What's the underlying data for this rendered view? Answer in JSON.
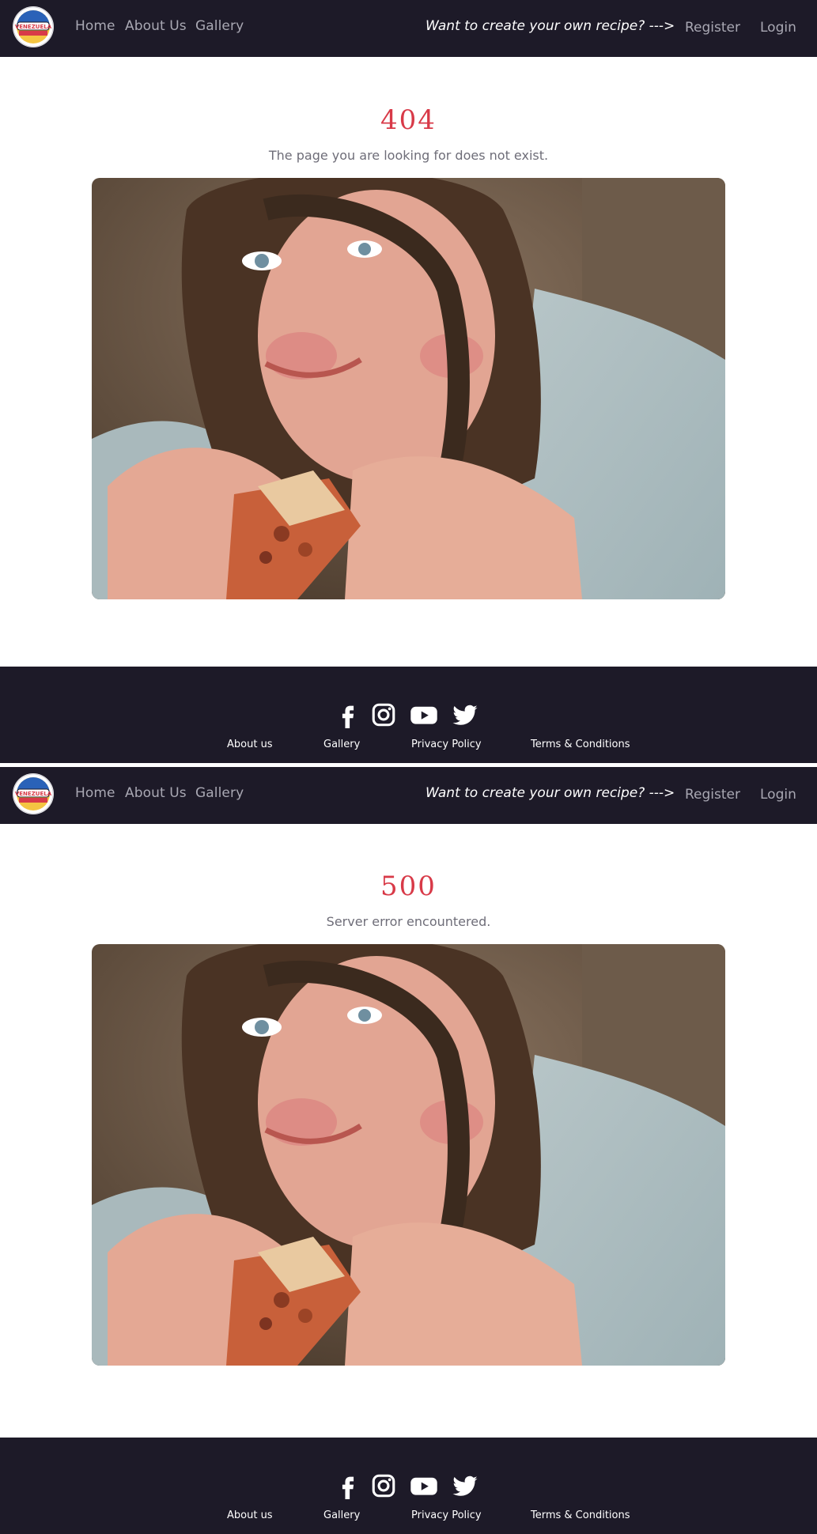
{
  "nav": {
    "logo_text": "VENEZUELA",
    "home": "Home",
    "about": "About Us",
    "gallery": "Gallery",
    "cta": "Want to create your own recipe? --->",
    "register": "Register",
    "login": "Login"
  },
  "pages": [
    {
      "code": "404",
      "message": "The page you are looking for does not exist."
    },
    {
      "code": "500",
      "message": "Server error encountered."
    }
  ],
  "footer": {
    "icons": [
      "facebook-icon",
      "instagram-icon",
      "youtube-icon",
      "twitter-icon"
    ],
    "about": "About us",
    "gallery": "Gallery",
    "privacy": "Privacy Policy",
    "terms": "Terms & Conditions"
  },
  "colors": {
    "nav_bg": "#1d1a28",
    "accent_red": "#d83a48",
    "muted_text": "#a9a8b3"
  }
}
